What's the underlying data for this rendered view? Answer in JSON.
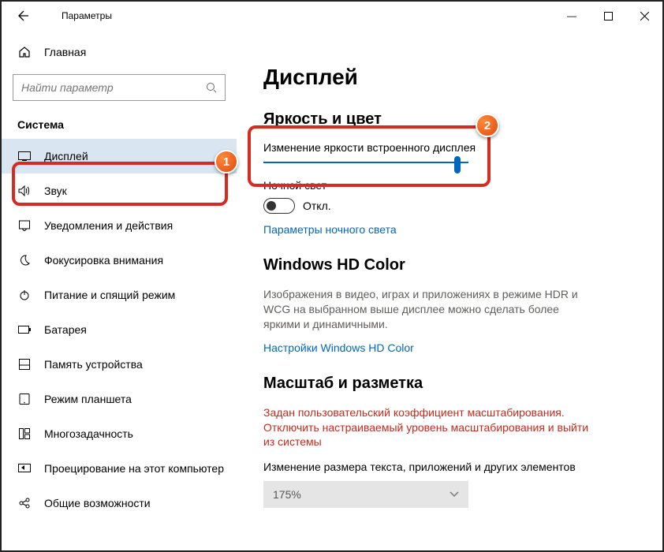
{
  "window": {
    "title": "Параметры",
    "min": "—",
    "max": "☐",
    "close": "✕"
  },
  "home": {
    "label": "Главная"
  },
  "search": {
    "placeholder": "Найти параметр"
  },
  "group": "Система",
  "nav": [
    {
      "label": "Дисплей"
    },
    {
      "label": "Звук"
    },
    {
      "label": "Уведомления и действия"
    },
    {
      "label": "Фокусировка внимания"
    },
    {
      "label": "Питание и спящий режим"
    },
    {
      "label": "Батарея"
    },
    {
      "label": "Память устройства"
    },
    {
      "label": "Режим планшета"
    },
    {
      "label": "Многозадачность"
    },
    {
      "label": "Проецирование на этот компьютер"
    },
    {
      "label": "Общие возможности"
    }
  ],
  "page": {
    "title": "Дисплей",
    "section_brightness": "Яркость и цвет",
    "brightness_label": "Изменение яркости встроенного дисплея",
    "slider_percent": 93,
    "night_light_label": "Ночной свет",
    "toggle_state": "Откл.",
    "night_link": "Параметры ночного света",
    "hdr_title": "Windows HD Color",
    "hdr_desc": "Изображения в видео, играх и приложениях в режиме HDR и WCG на выбранном выше дисплее можно сделать более яркими и динамичными.",
    "hdr_link": "Настройки Windows HD Color",
    "scale_title": "Масштаб и разметка",
    "scale_warn": "Задан пользовательский коэффициент масштабирования. Отключить настраиваемый уровень масштабирования и выйти из системы",
    "scale_label": "Изменение размера текста, приложений и других элементов",
    "scale_value": "175%"
  },
  "annotations": {
    "one": "1",
    "two": "2"
  }
}
